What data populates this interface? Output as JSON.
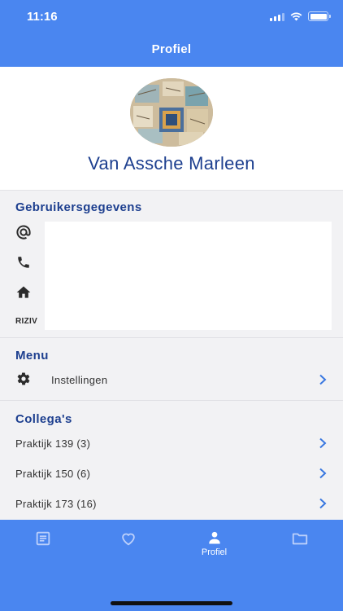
{
  "status_bar": {
    "time": "11:16"
  },
  "header": {
    "title": "Profiel"
  },
  "profile": {
    "name": "Van Assche Marleen"
  },
  "user_details": {
    "title": "Gebruikersgegevens",
    "riziv_label": "RIZIV",
    "icons": [
      "at-icon",
      "phone-icon",
      "home-icon"
    ]
  },
  "menu": {
    "title": "Menu",
    "items": [
      {
        "label": "Instellingen",
        "icon": "gear-icon"
      }
    ]
  },
  "colleagues": {
    "title": "Collega's",
    "items": [
      {
        "label": "Praktijk 139 (3)"
      },
      {
        "label": "Praktijk 150 (6)"
      },
      {
        "label": "Praktijk 173 (16)"
      }
    ]
  },
  "tabbar": {
    "tabs": [
      {
        "icon": "list-icon",
        "label": ""
      },
      {
        "icon": "heart-icon",
        "label": ""
      },
      {
        "icon": "person-icon",
        "label": "Profiel",
        "active": true
      },
      {
        "icon": "folder-icon",
        "label": ""
      }
    ]
  },
  "colors": {
    "primary": "#4a86f0",
    "title_text": "#1d3f8f",
    "chevron": "#3a78e0",
    "background": "#f2f2f4"
  }
}
